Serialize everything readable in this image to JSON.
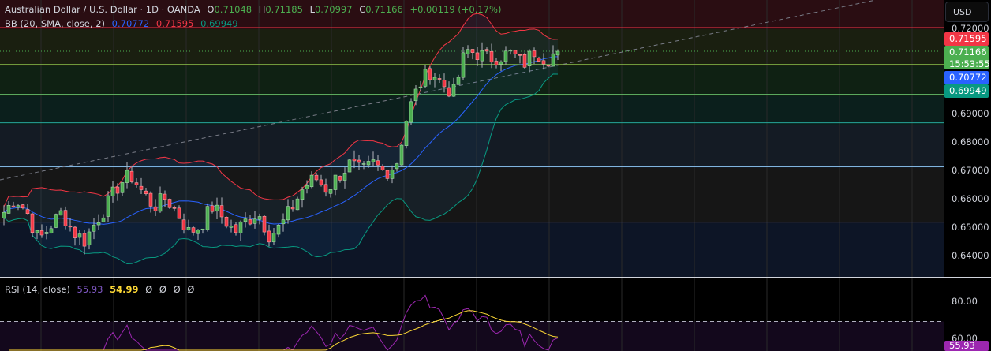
{
  "header": {
    "symbol_title": "Australian Dollar / U.S. Dollar · 1D · OANDA",
    "open_label": "O",
    "open": "0.71048",
    "high_label": "H",
    "high": "0.71185",
    "low_label": "L",
    "low": "0.70997",
    "close_label": "C",
    "close": "0.71166",
    "change": "+0.00119 (+0.17%)"
  },
  "bb_legend": {
    "label": "BB (20, SMA, close, 2)",
    "basis": "0.70772",
    "upper": "0.71595",
    "lower": "0.69949"
  },
  "rsi_legend": {
    "label": "RSI (14, close)",
    "rsi": "55.93",
    "ma": "54.99",
    "empty": [
      "Ø",
      "Ø",
      "Ø",
      "Ø"
    ]
  },
  "price_axis": {
    "currency_button": "USD",
    "ticks": [
      "0.72000",
      "0.69000",
      "0.68000",
      "0.67000",
      "0.66000",
      "0.65000",
      "0.64000"
    ],
    "tick_values": [
      0.72,
      0.69,
      0.68,
      0.67,
      0.66,
      0.65,
      0.64
    ],
    "badges": {
      "upper": "0.71595",
      "last": "0.71166",
      "countdown": "15:53:55",
      "basis": "0.70772",
      "lower": "0.69949"
    }
  },
  "rsi_axis": {
    "ticks": [
      "80.00",
      "60.00"
    ],
    "tick_values": [
      80,
      60
    ],
    "badge": "55.93"
  },
  "colors": {
    "up": "#4caf50",
    "down": "#f23645",
    "basis": "#2962ff",
    "upper": "#f23645",
    "lower": "#089981",
    "rsi": "#7e57c2",
    "rsi_ma": "#fdd835"
  },
  "chart_data": {
    "type": "candlestick",
    "price_range": [
      0.633,
      0.7215
    ],
    "horizontal_levels": [
      0.72,
      0.707,
      0.6965,
      0.6865,
      0.671,
      0.6515
    ],
    "close_path_keypoints": [
      0.655,
      0.66,
      0.655,
      0.645,
      0.65,
      0.655,
      0.648,
      0.645,
      0.652,
      0.658,
      0.665,
      0.668,
      0.662,
      0.657,
      0.66,
      0.655,
      0.648,
      0.65,
      0.657,
      0.653,
      0.648,
      0.652,
      0.655,
      0.647,
      0.65,
      0.657,
      0.664,
      0.667,
      0.663,
      0.668,
      0.672,
      0.669,
      0.672,
      0.669,
      0.672,
      0.69,
      0.7,
      0.705,
      0.7,
      0.697,
      0.712,
      0.711,
      0.709,
      0.71,
      0.711,
      0.707,
      0.712,
      0.709,
      0.71166
    ]
  }
}
